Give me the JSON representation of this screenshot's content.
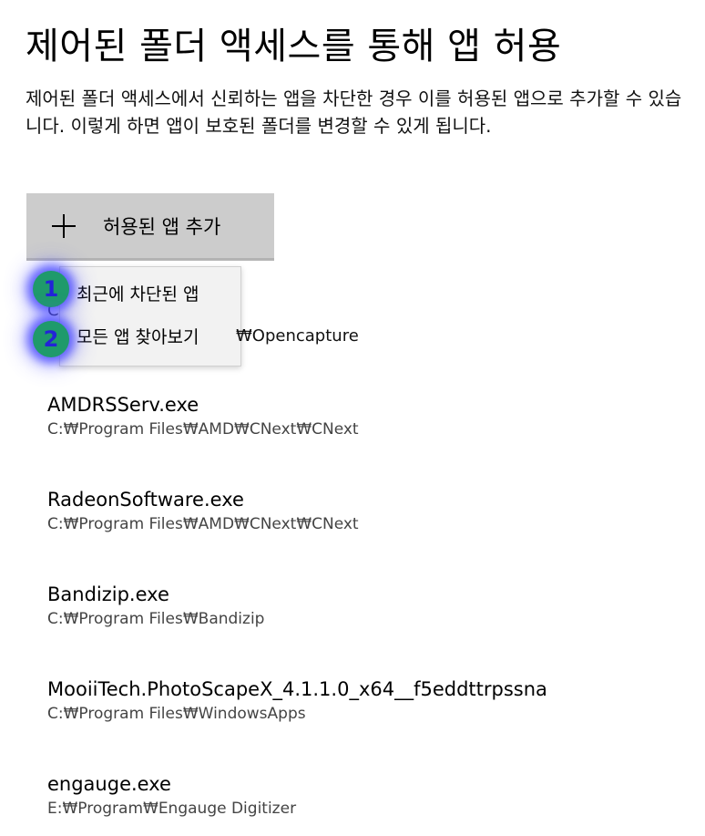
{
  "page": {
    "title": "제어된 폴더 액세스를 통해 앱 허용",
    "description": "제어된 폴더 액세스에서 신뢰하는 앱을 차단한 경우 이를 허용된 앱으로 추가할 수 있습니다. 이렇게 하면 앱이 보호된 폴더를 변경할 수 있게 됩니다."
  },
  "add_button": {
    "label": "허용된 앱 추가",
    "icon": "plus-icon"
  },
  "menu": {
    "items": [
      {
        "label": "최근에 차단된 앱",
        "badge": "1"
      },
      {
        "label": "모든 앱 찾아보기",
        "badge": "2"
      }
    ]
  },
  "first_app_partial": {
    "path_end": "₩Opencapture",
    "name_start": "C"
  },
  "apps": [
    {
      "name": "AMDRSServ.exe",
      "path": "C:₩Program Files₩AMD₩CNext₩CNext"
    },
    {
      "name": "RadeonSoftware.exe",
      "path": "C:₩Program Files₩AMD₩CNext₩CNext"
    },
    {
      "name": "Bandizip.exe",
      "path": "C:₩Program Files₩Bandizip"
    },
    {
      "name": "MooiiTech.PhotoScapeX_4.1.1.0_x64__f5eddttrpssna",
      "path": "C:₩Program Files₩WindowsApps"
    },
    {
      "name": "engauge.exe",
      "path": "E:₩Program₩Engauge Digitizer"
    }
  ]
}
